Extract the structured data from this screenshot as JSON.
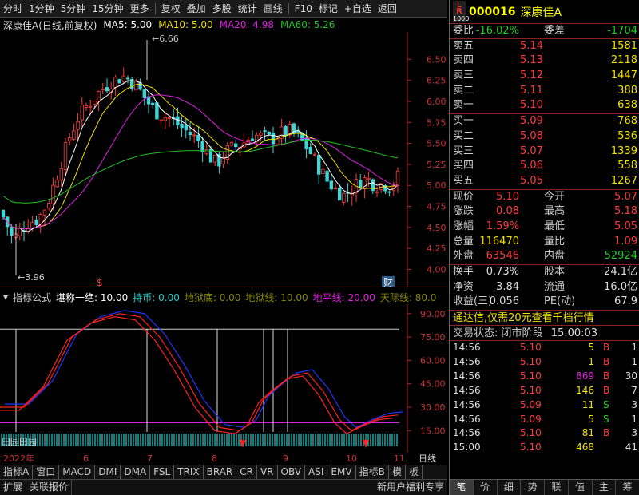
{
  "toolbar": {
    "items": [
      "分时",
      "1分钟",
      "5分钟",
      "15分钟",
      "更多",
      "复权",
      "叠加",
      "多股",
      "统计",
      "画线",
      "F10",
      "标记",
      "+自选",
      "返回"
    ]
  },
  "title": {
    "name": "深康佳A",
    "mode": "(日线,前复权)",
    "ma5": "MA5: 5.00",
    "ma10": "MA10: 5.00",
    "ma20": "MA20: 4.98",
    "ma60": "MA60: 5.26"
  },
  "colors": {
    "up": "#ff3b3b",
    "down": "#1ecf1e",
    "ma5": "#ffffff",
    "ma10": "#f0e000",
    "ma20": "#e020e0",
    "ma60": "#20c020"
  },
  "main_chart": {
    "y_ticks": [
      "6.50",
      "6.25",
      "6.00",
      "5.75",
      "5.50",
      "5.25",
      "5.00",
      "4.75",
      "4.50",
      "4.25",
      "4.00"
    ],
    "high_label": "6.66",
    "low_label": "3.96",
    "marker_s": "$",
    "marker_cai": "财"
  },
  "indicator": {
    "name": "指标公式",
    "params": [
      {
        "label": "堪称一绝: 10.00",
        "color": "#ffffff"
      },
      {
        "label": "持币: 0.00",
        "color": "#1ecfcf"
      },
      {
        "label": "地狱底: 0.00",
        "color": "#888800"
      },
      {
        "label": "地狱线: 10.00",
        "color": "#888800"
      },
      {
        "label": "地平线: 20.00",
        "color": "#e020e0"
      },
      {
        "label": "天际线: 80.0",
        "color": "#888800"
      }
    ],
    "y_ticks": [
      "90.00",
      "75.00",
      "60.00",
      "45.00",
      "30.00",
      "15.00"
    ],
    "bottom_text": "田园田园"
  },
  "dates": {
    "labels": [
      "2022年",
      "6",
      "7",
      "8",
      "9",
      "10",
      "11"
    ],
    "period": "日线"
  },
  "tabs1": [
    "指标A",
    "窗口",
    "MACD",
    "DMI",
    "DMA",
    "FSL",
    "TRIX",
    "BRAR",
    "CR",
    "VR",
    "OBV",
    "ASI",
    "EMV",
    "指标B",
    "模",
    "板"
  ],
  "tabs2": {
    "left": [
      "扩展",
      "关联报价"
    ],
    "right": "新用户福利专享"
  },
  "quote": {
    "lr_top": "L",
    "lr_mid": "R",
    "lr_bot": "1000",
    "code": "000016",
    "name": "深康佳A",
    "webi_label": "委比",
    "webi": "-16.02%",
    "weicha_label": "委差",
    "weicha": "-1704",
    "asks": [
      {
        "label": "卖五",
        "price": "5.14",
        "vol": "1581"
      },
      {
        "label": "卖四",
        "price": "5.13",
        "vol": "2118"
      },
      {
        "label": "卖三",
        "price": "5.12",
        "vol": "1447"
      },
      {
        "label": "卖二",
        "price": "5.11",
        "vol": "388"
      },
      {
        "label": "卖一",
        "price": "5.10",
        "vol": "638"
      }
    ],
    "bids": [
      {
        "label": "买一",
        "price": "5.09",
        "vol": "768"
      },
      {
        "label": "买二",
        "price": "5.08",
        "vol": "536"
      },
      {
        "label": "买三",
        "price": "5.07",
        "vol": "1339"
      },
      {
        "label": "买四",
        "price": "5.06",
        "vol": "558"
      },
      {
        "label": "买五",
        "price": "5.05",
        "vol": "1267"
      }
    ],
    "stats": [
      {
        "l1": "现价",
        "v1": "5.10",
        "c1": "red",
        "l2": "今开",
        "v2": "5.07",
        "c2": "red"
      },
      {
        "l1": "涨跌",
        "v1": "0.08",
        "c1": "red",
        "l2": "最高",
        "v2": "5.18",
        "c2": "red"
      },
      {
        "l1": "涨幅",
        "v1": "1.59%",
        "c1": "red",
        "l2": "最低",
        "v2": "5.05",
        "c2": "red"
      },
      {
        "l1": "总量",
        "v1": "116470",
        "c1": "yellow",
        "l2": "量比",
        "v2": "1.09",
        "c2": "red"
      },
      {
        "l1": "外盘",
        "v1": "63546",
        "c1": "red",
        "l2": "内盘",
        "v2": "52924",
        "c2": "green"
      }
    ],
    "stats2": [
      {
        "l1": "换手",
        "v1": "0.73%",
        "l2": "股本",
        "v2": "24.1亿"
      },
      {
        "l1": "净资",
        "v1": "3.84",
        "l2": "流通",
        "v2": "16.0亿"
      },
      {
        "l1": "收益(三)",
        "v1": "0.056",
        "l2": "PE(动)",
        "v2": "67.9"
      }
    ],
    "ad": "通达信,仅需20元查看千档行情",
    "status_label": "交易状态:",
    "status_value": "闭市阶段",
    "status_time": "15:00:03",
    "ticks": [
      {
        "time": "14:56",
        "price": "5.10",
        "vol": "5",
        "vc": "yellow",
        "bs": "B",
        "bsc": "red",
        "n": "1"
      },
      {
        "time": "14:56",
        "price": "5.10",
        "vol": "1",
        "vc": "yellow",
        "bs": "B",
        "bsc": "red",
        "n": "1"
      },
      {
        "time": "14:56",
        "price": "5.10",
        "vol": "869",
        "vc": "magenta",
        "bs": "B",
        "bsc": "red",
        "n": "30"
      },
      {
        "time": "14:56",
        "price": "5.10",
        "vol": "146",
        "vc": "yellow",
        "bs": "B",
        "bsc": "red",
        "n": "7"
      },
      {
        "time": "14:56",
        "price": "5.09",
        "vol": "11",
        "vc": "yellow",
        "bs": "S",
        "bsc": "green",
        "n": "3"
      },
      {
        "time": "14:56",
        "price": "5.09",
        "vol": "5",
        "vc": "yellow",
        "bs": "S",
        "bsc": "green",
        "n": "1"
      },
      {
        "time": "14:56",
        "price": "5.10",
        "vol": "81",
        "vc": "yellow",
        "bs": "B",
        "bsc": "red",
        "n": "3"
      },
      {
        "time": "15:00",
        "price": "5.10",
        "vol": "468",
        "vc": "yellow",
        "bs": "",
        "bsc": "red",
        "n": "41"
      }
    ],
    "tabs": [
      "笔",
      "价",
      "细",
      "势",
      "联",
      "值",
      "主",
      "筹"
    ]
  }
}
